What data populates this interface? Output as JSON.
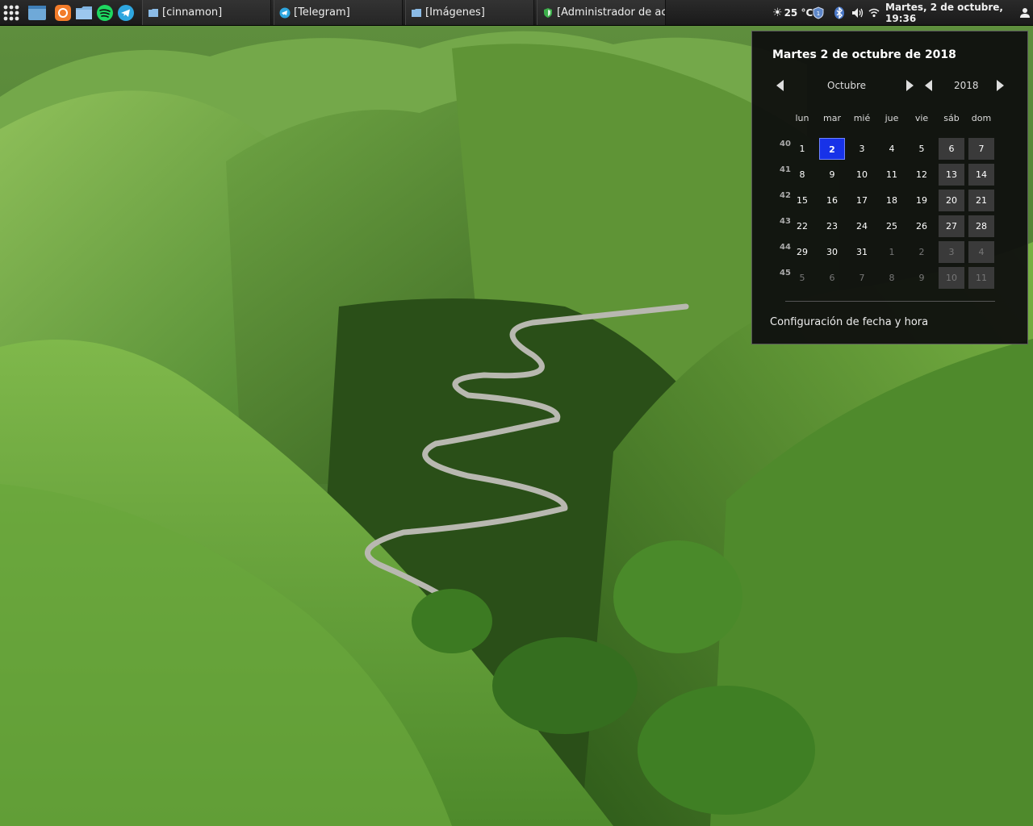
{
  "taskbar": {
    "launchers": [
      "menu-icon",
      "show-desktop-icon",
      "firefox-icon",
      "files-icon",
      "spotify-icon",
      "telegram-icon"
    ],
    "windows": [
      {
        "label": "[cinnamon]",
        "icon": "folder-icon"
      },
      {
        "label": "[Telegram]",
        "icon": "telegram-icon"
      },
      {
        "label": "[Imágenes]",
        "icon": "folder-icon"
      },
      {
        "label": "[Administrador de act...",
        "icon": "shield-icon"
      }
    ]
  },
  "tray": {
    "weather": "25 °C",
    "clock": "Martes,  2 de octubre, 19:36",
    "icons": [
      "sun-icon",
      "shield-icon",
      "bluetooth-icon",
      "volume-icon",
      "wifi-icon",
      "user-icon"
    ]
  },
  "calendar": {
    "title": "Martes 2 de octubre de 2018",
    "month": "Octubre",
    "year": "2018",
    "weekdays": [
      "lun",
      "mar",
      "mié",
      "jue",
      "vie",
      "sáb",
      "dom"
    ],
    "week_numbers": [
      "40",
      "41",
      "42",
      "43",
      "44",
      "45"
    ],
    "days": [
      [
        "1",
        "2",
        "3",
        "4",
        "5",
        "6",
        "7"
      ],
      [
        "8",
        "9",
        "10",
        "11",
        "12",
        "13",
        "14"
      ],
      [
        "15",
        "16",
        "17",
        "18",
        "19",
        "20",
        "21"
      ],
      [
        "22",
        "23",
        "24",
        "25",
        "26",
        "27",
        "28"
      ],
      [
        "29",
        "30",
        "31",
        "1",
        "2",
        "3",
        "4"
      ],
      [
        "5",
        "6",
        "7",
        "8",
        "9",
        "10",
        "11"
      ]
    ],
    "today": "2",
    "settings_link": "Configuración de fecha y hora"
  },
  "colors": {
    "panel": "#1f1f1f",
    "today_highlight": "#1732e8",
    "popup_bg": "#0e0e0e"
  }
}
